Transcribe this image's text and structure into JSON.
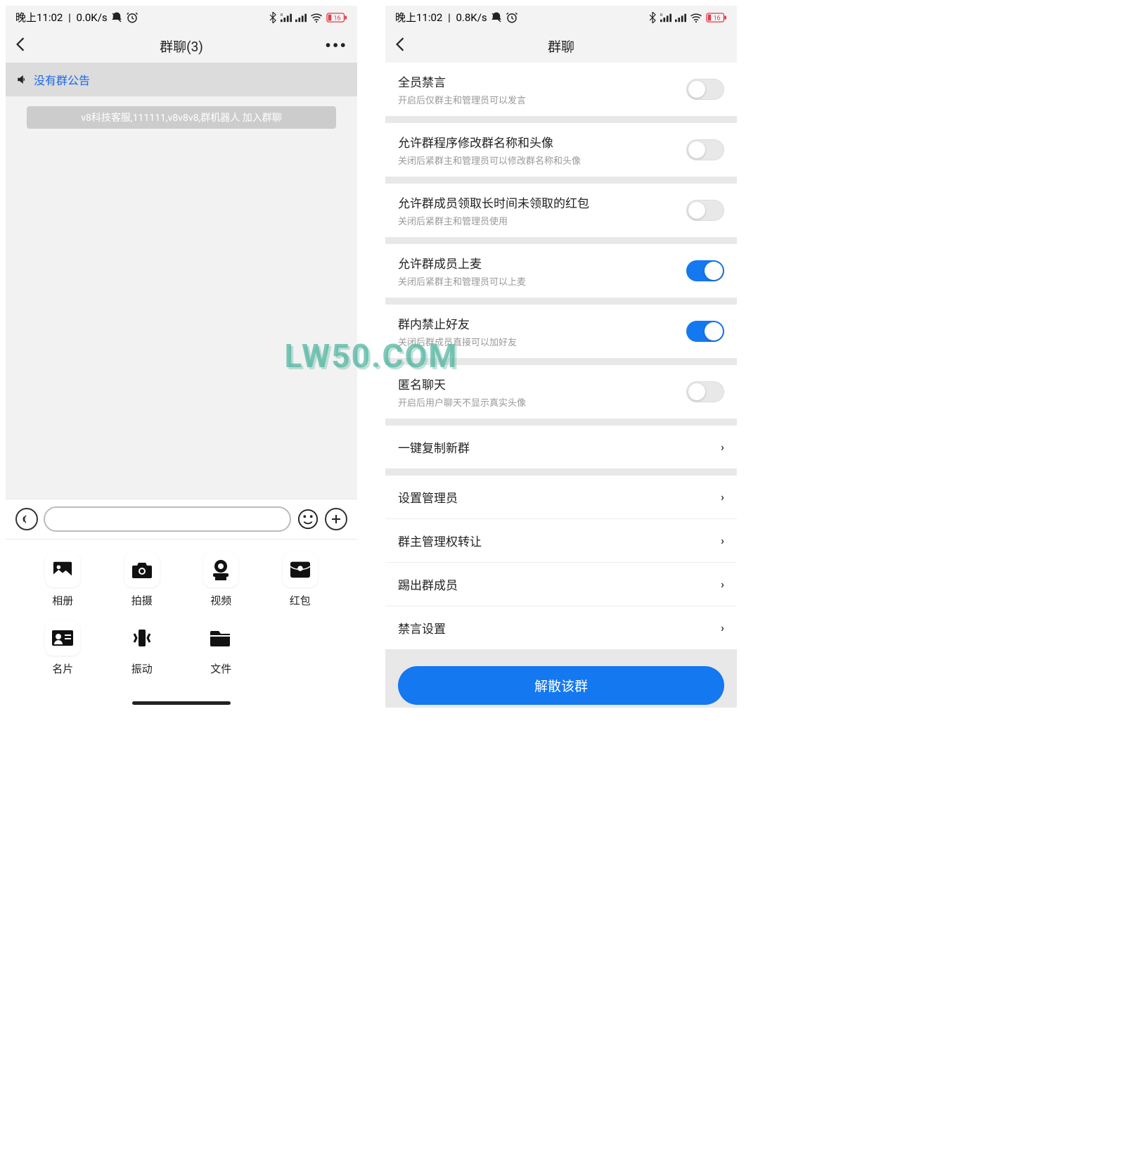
{
  "watermark": "LW50.COM",
  "left": {
    "status": {
      "time": "晚上11:02",
      "speed": "0.0K/s",
      "battery": "16"
    },
    "nav": {
      "title": "群聊(3)"
    },
    "announce": "没有群公告",
    "system_message": "v8科技客服,111111,v8v8v8,群机器人 加入群聊",
    "attach": [
      {
        "label": "相册",
        "icon": "image"
      },
      {
        "label": "拍摄",
        "icon": "camera"
      },
      {
        "label": "视频",
        "icon": "videocam"
      },
      {
        "label": "红包",
        "icon": "redpacket"
      },
      {
        "label": "名片",
        "icon": "card"
      },
      {
        "label": "振动",
        "icon": "vibrate"
      },
      {
        "label": "文件",
        "icon": "folder"
      }
    ]
  },
  "right": {
    "status": {
      "time": "晚上11:02",
      "speed": "0.8K/s",
      "battery": "16"
    },
    "nav": {
      "title": "群聊"
    },
    "toggles": [
      {
        "title": "全员禁言",
        "sub": "开启后仅群主和管理员可以发言",
        "on": false
      },
      {
        "title": "允许群程序修改群名称和头像",
        "sub": "关闭后紧群主和管理员可以修改群名称和头像",
        "on": false
      },
      {
        "title": "允许群成员领取长时间未领取的红包",
        "sub": "关闭后紧群主和管理员使用",
        "on": false
      },
      {
        "title": "允许群成员上麦",
        "sub": "关闭后紧群主和管理员可以上麦",
        "on": true
      },
      {
        "title": "群内禁止好友",
        "sub": "关闭后群成员直接可以加好友",
        "on": true
      },
      {
        "title": "匿名聊天",
        "sub": "开启后用户聊天不显示真实头像",
        "on": false
      }
    ],
    "links_single": [
      {
        "title": "一键复制新群"
      }
    ],
    "links_group": [
      {
        "title": "设置管理员"
      },
      {
        "title": "群主管理权转让"
      },
      {
        "title": "踢出群成员"
      },
      {
        "title": "禁言设置"
      }
    ],
    "dissolve": "解散该群"
  }
}
